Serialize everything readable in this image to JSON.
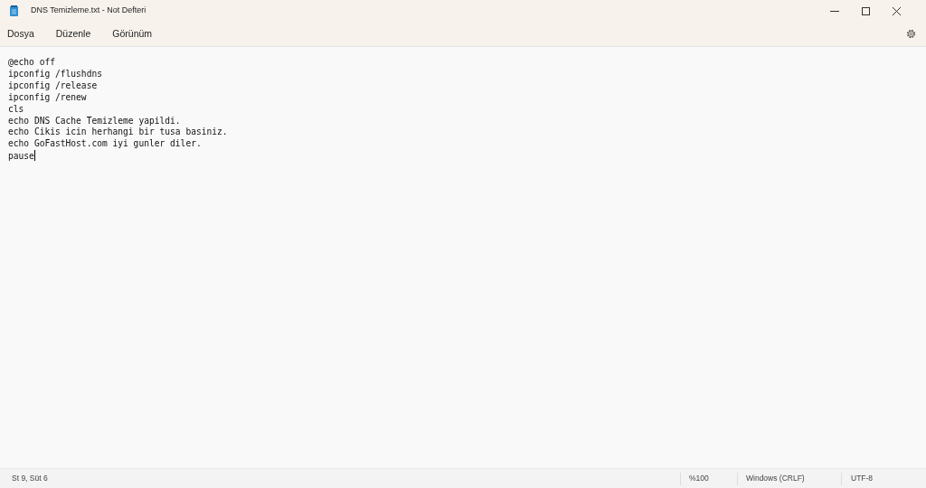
{
  "window": {
    "title": "DNS Temizleme.txt - Not Defteri"
  },
  "menu": [
    "Dosya",
    "Düzenle",
    "Görünüm"
  ],
  "editor": {
    "lines": [
      "@echo off",
      "ipconfig /flushdns",
      "ipconfig /release",
      "ipconfig /renew",
      "cls",
      "echo DNS Cache Temizleme yapildi.",
      "echo Cikis icin herhangi bir tusa basiniz.",
      "echo GoFastHost.com iyi gunler diler.",
      "pause"
    ]
  },
  "status_bar": {
    "position": "St 9, Süt 6",
    "zoom": "%100",
    "line_ending": "Windows (CRLF)",
    "encoding": "UTF-8"
  }
}
